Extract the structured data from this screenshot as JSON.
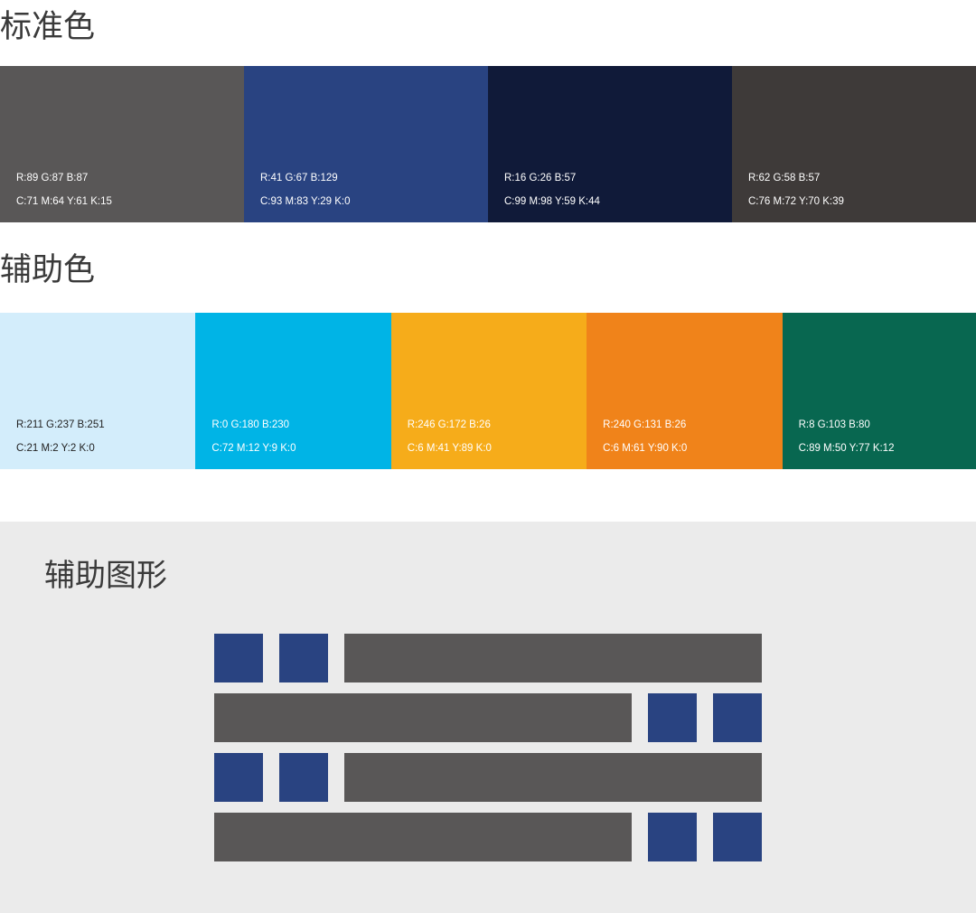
{
  "standard": {
    "title": "标准色",
    "swatches": [
      {
        "color": "#595757",
        "rgb": "R:89 G:87 B:87",
        "cmyk": "C:71 M:64 Y:61 K:15"
      },
      {
        "color": "#294381",
        "rgb": "R:41 G:67 B:129",
        "cmyk": "C:93 M:83 Y:29 K:0"
      },
      {
        "color": "#101A39",
        "rgb": "R:16 G:26 B:57",
        "cmyk": "C:99 M:98 Y:59 K:44"
      },
      {
        "color": "#3E3A39",
        "rgb": "R:62 G:58 B:57",
        "cmyk": "C:76 M:72 Y:70 K:39"
      }
    ]
  },
  "auxiliary": {
    "title": "辅助色",
    "swatches": [
      {
        "color": "#D3EDFB",
        "rgb": "R:211 G:237 B:251",
        "cmyk": "C:21 M:2 Y:2 K:0"
      },
      {
        "color": "#00B4E6",
        "rgb": "R:0 G:180 B:230",
        "cmyk": "C:72 M:12 Y:9 K:0"
      },
      {
        "color": "#F6AC1A",
        "rgb": "R:246 G:172 B:26",
        "cmyk": "C:6 M:41 Y:89 K:0"
      },
      {
        "color": "#F0831A",
        "rgb": "R:240 G:131 B:26",
        "cmyk": "C:6 M:61 Y:90 K:0"
      },
      {
        "color": "#086750",
        "rgb": "R:8 G:103 B:80",
        "cmyk": "C:89 M:50 Y:77 K:12"
      }
    ]
  },
  "pattern": {
    "title": "辅助图形",
    "square_color": "#294381",
    "bar_color": "#595757",
    "background": "#EBEBEB"
  }
}
